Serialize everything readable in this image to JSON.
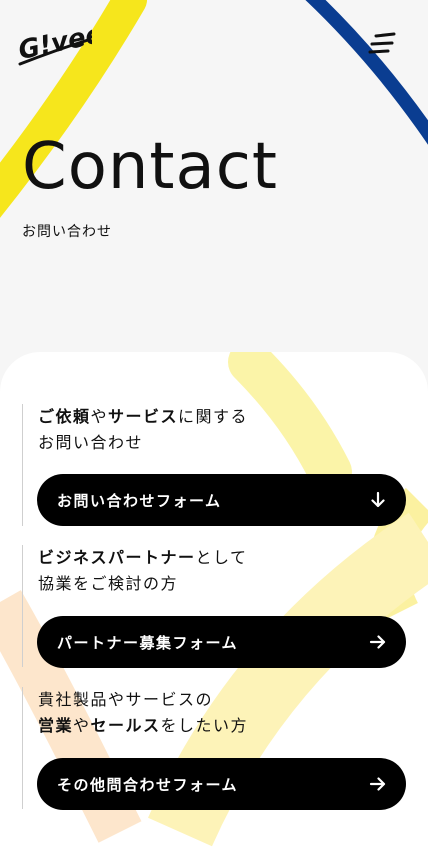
{
  "logo": {
    "text": "G!vee"
  },
  "hero": {
    "title": "Contact",
    "subtitle": "お問い合わせ"
  },
  "colors": {
    "yellow": "#f6e61c",
    "blue": "#0a3d91",
    "black": "#000000"
  },
  "contact_sections": [
    {
      "line1": [
        {
          "text": "ご依頼",
          "bold": true
        },
        {
          "text": "や",
          "bold": false
        },
        {
          "text": "サービス",
          "bold": true
        },
        {
          "text": "に関する",
          "bold": false
        }
      ],
      "line2": [
        {
          "text": "お問い合わせ",
          "bold": false
        }
      ],
      "button": {
        "label": "お問い合わせフォーム",
        "icon": "arrow-down-icon"
      }
    },
    {
      "line1": [
        {
          "text": "ビジネスパートナー",
          "bold": true
        },
        {
          "text": "として",
          "bold": false
        }
      ],
      "line2": [
        {
          "text": "協業をご検討の方",
          "bold": false
        }
      ],
      "button": {
        "label": "パートナー募集フォーム",
        "icon": "arrow-right-icon"
      }
    },
    {
      "line1": [
        {
          "text": "貴社製品やサービスの",
          "bold": false
        }
      ],
      "line2": [
        {
          "text": "営業",
          "bold": true
        },
        {
          "text": "や",
          "bold": false
        },
        {
          "text": "セールス",
          "bold": true
        },
        {
          "text": "をしたい方",
          "bold": false
        }
      ],
      "button": {
        "label": "その他問合わせフォーム",
        "icon": "arrow-right-icon"
      }
    }
  ]
}
